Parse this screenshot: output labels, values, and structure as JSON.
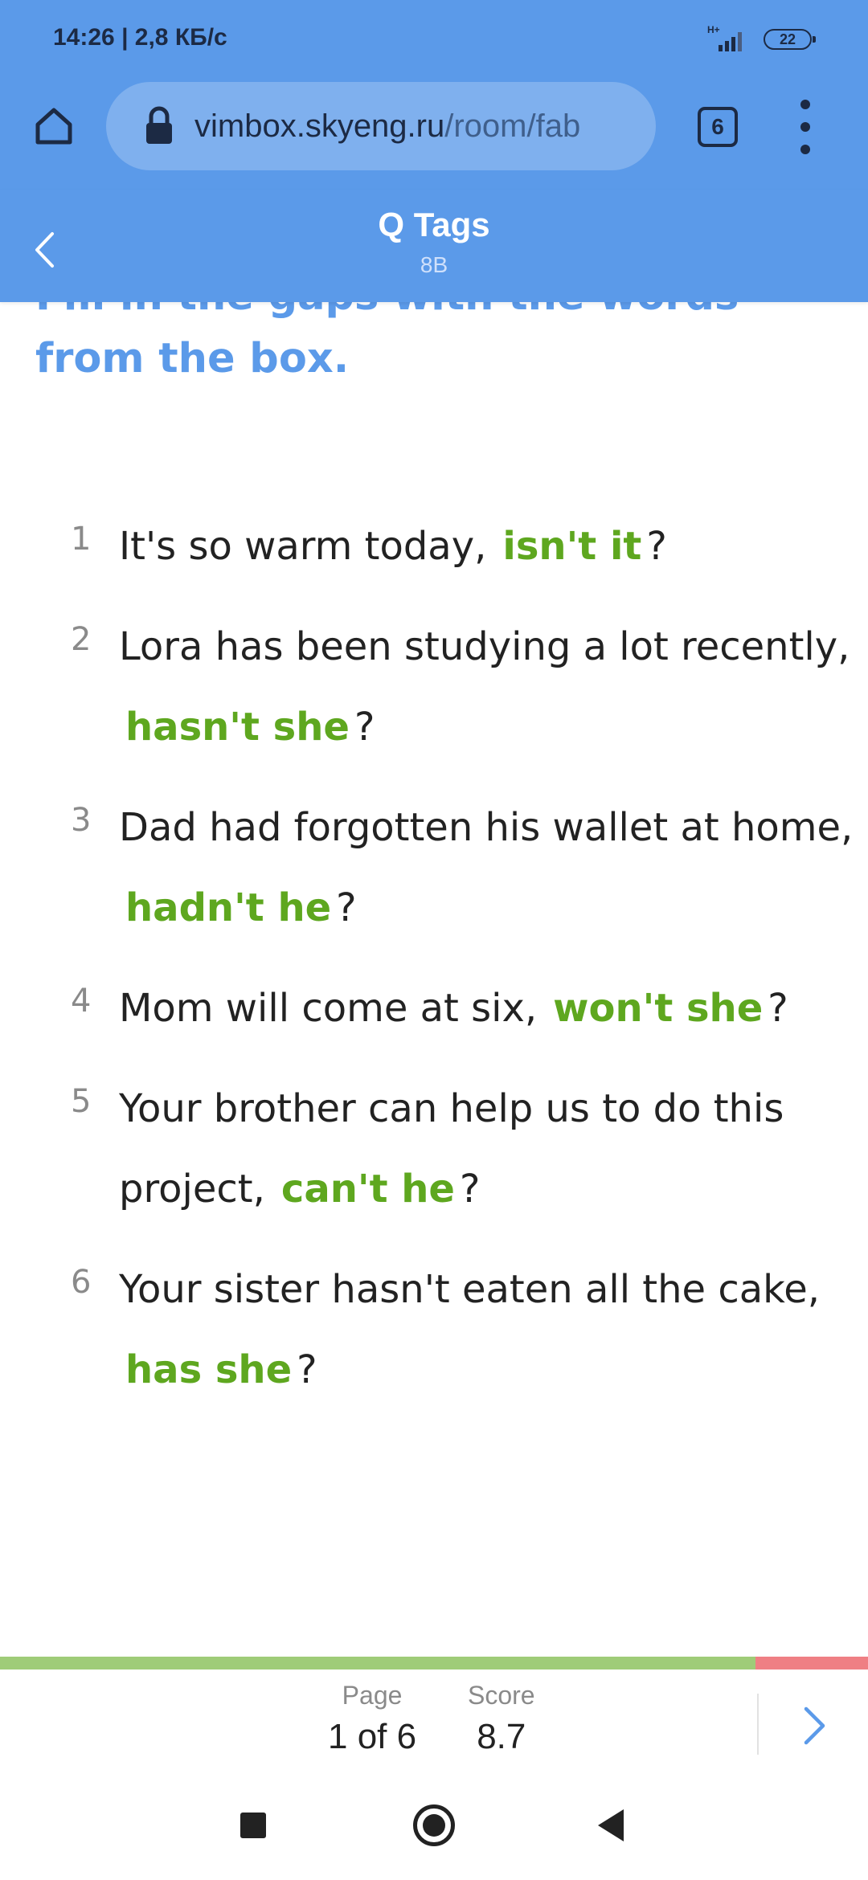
{
  "status_bar": {
    "time": "14:26 | 2,8 КБ/с",
    "network": "H+",
    "battery": "22"
  },
  "browser": {
    "url_host": "vimbox.skyeng.ru",
    "url_path": "/room/fab",
    "tab_count": "6"
  },
  "lesson": {
    "title": "Q Tags",
    "subtitle": "8B"
  },
  "instruction": "Fill in the gaps with the words from the box.",
  "exercises": [
    {
      "num": "1",
      "line1": "It's so warm today,",
      "answer": "isn't it",
      "q": "?"
    },
    {
      "num": "2",
      "line1": "Lora has been studying a lot recently,",
      "answer": "hasn't she",
      "q": "?"
    },
    {
      "num": "3",
      "line1": "Dad had forgotten his wallet at home,",
      "answer": "hadn't he",
      "q": "?"
    },
    {
      "num": "4",
      "line1": "Mom will come at six,",
      "answer": "won't she",
      "q": "?"
    },
    {
      "num": "5",
      "line1": "Your brother can help us to do this",
      "line2": "project,",
      "answer": "can't he",
      "q": "?"
    },
    {
      "num": "6",
      "line1": "Your sister hasn't eaten all the cake,",
      "answer": "has she",
      "q": "?"
    }
  ],
  "footer": {
    "page_label": "Page",
    "page_value": "1 of 6",
    "score_label": "Score",
    "score_value": "8.7",
    "progress_fraction": 0.87
  },
  "colors": {
    "accent": "#5b9ae9",
    "answer": "#5ea71f",
    "progress_good": "#9fcc78",
    "progress_bad": "#ef7f84"
  }
}
